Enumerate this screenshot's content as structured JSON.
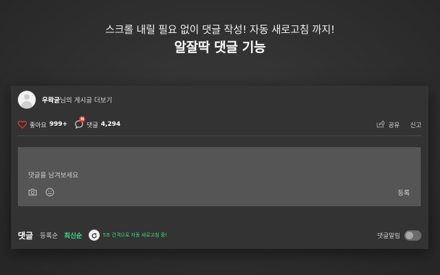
{
  "hero": {
    "subtitle": "스크롤 내릴 필요 없이 댓글 작성! 자동 새로고침 까지!",
    "title": "알잘딱 댓글 기능"
  },
  "post": {
    "author_name": "우왁굳",
    "author_suffix": "님의 게시글 더보기",
    "like_label": "좋아요",
    "like_count": "999+",
    "comment_label": "댓글",
    "comment_count": "4,294",
    "new_badge": "N",
    "share_label": "공유",
    "report_label": "신고"
  },
  "composer": {
    "placeholder": "댓글을 남겨보세요",
    "submit_label": "등록"
  },
  "comments_bar": {
    "title": "댓글",
    "sort_options": [
      "등록순",
      "최신순"
    ],
    "active_sort": "최신순",
    "refresh_note": "5초 간격으로 자동 새로고침 중!",
    "alarm_label": "댓글알림",
    "alarm_enabled": false
  },
  "colors": {
    "accent_green": "#3ddc84",
    "heart_red": "#e53935",
    "background": "#2f2f2f",
    "card": "#333333",
    "input": "#555555"
  },
  "icons": [
    "heart-icon",
    "comment-icon",
    "share-icon",
    "camera-icon",
    "smile-icon",
    "refresh-icon"
  ]
}
